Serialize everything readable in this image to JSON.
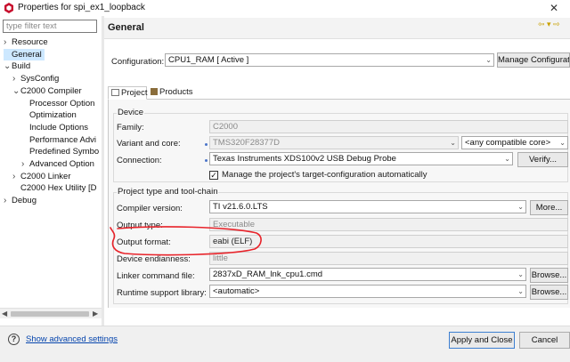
{
  "window": {
    "title": "Properties for spi_ex1_loopback",
    "close_glyph": "✕"
  },
  "tree": {
    "filter_placeholder": "type filter text",
    "items": [
      {
        "label": "Resource",
        "level": 0,
        "expandable": true,
        "expanded": false
      },
      {
        "label": "General",
        "level": 0,
        "expandable": false,
        "selected": true
      },
      {
        "label": "Build",
        "level": 0,
        "expandable": true,
        "expanded": true
      },
      {
        "label": "SysConfig",
        "level": 1,
        "expandable": true,
        "expanded": false
      },
      {
        "label": "C2000 Compiler",
        "level": 1,
        "expandable": true,
        "expanded": true
      },
      {
        "label": "Processor Option",
        "level": 2,
        "expandable": false
      },
      {
        "label": "Optimization",
        "level": 2,
        "expandable": false
      },
      {
        "label": "Include Options",
        "level": 2,
        "expandable": false
      },
      {
        "label": "Performance Advi",
        "level": 2,
        "expandable": false
      },
      {
        "label": "Predefined Symbo",
        "level": 2,
        "expandable": false
      },
      {
        "label": "Advanced Option",
        "level": 2,
        "expandable": true,
        "expanded": false
      },
      {
        "label": "C2000 Linker",
        "level": 1,
        "expandable": true,
        "expanded": false
      },
      {
        "label": "C2000 Hex Utility  [D",
        "level": 1,
        "expandable": false
      },
      {
        "label": "Debug",
        "level": 0,
        "expandable": true,
        "expanded": false
      }
    ]
  },
  "page": {
    "title": "General",
    "nav_arrows": "⇦ ▾ ⇨"
  },
  "configuration": {
    "label": "Configuration:",
    "value": "CPU1_RAM  [ Active ]",
    "manage_button": "Manage Configurations..."
  },
  "tabs": [
    {
      "label": "Project",
      "active": true
    },
    {
      "label": "Products",
      "active": false
    }
  ],
  "device": {
    "group_label": "Device",
    "family_label": "Family:",
    "family_value": "C2000",
    "variant_label": "Variant and core:",
    "variant_value": "TMS320F28377D",
    "core_value": "<any compatible core>",
    "connection_label": "Connection:",
    "connection_value": "Texas Instruments XDS100v2 USB Debug Probe",
    "verify_button": "Verify...",
    "manage_target_checkbox_label": "Manage the project's target-configuration automatically",
    "manage_target_checked": true
  },
  "toolchain": {
    "group_label": "Project type and tool-chain",
    "compiler_label": "Compiler version:",
    "compiler_value": "TI v21.6.0.LTS",
    "more_button": "More...",
    "output_type_label": "Output type:",
    "output_type_value": "Executable",
    "output_format_label": "Output format:",
    "output_format_value": "eabi (ELF)",
    "endianness_label": "Device endianness:",
    "endianness_value": "little",
    "linker_file_label": "Linker command file:",
    "linker_file_value": "2837xD_RAM_lnk_cpu1.cmd",
    "browse_button": "Browse...",
    "runtime_label": "Runtime support library:",
    "runtime_value": "<automatic>",
    "browse_button_2": "Browse..."
  },
  "footer": {
    "help_glyph": "?",
    "show_advanced": "Show advanced settings",
    "apply_close": "Apply and Close",
    "cancel": "Cancel"
  },
  "colors": {
    "annotation_red": "#e8232a",
    "selection": "#cde8ff",
    "link": "#0645ad"
  }
}
